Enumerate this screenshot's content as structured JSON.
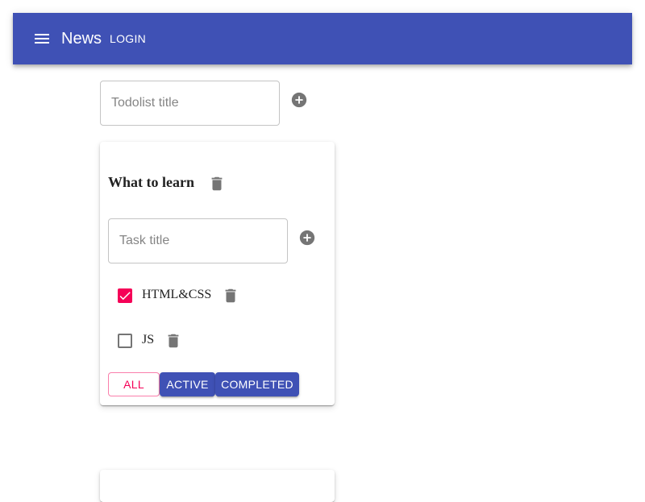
{
  "appbar": {
    "title": "News",
    "login_label": "LOGIN",
    "color": "#3f51b5",
    "menu_icon": "menu-icon"
  },
  "new_todolist": {
    "placeholder": "Todolist title",
    "value": "",
    "add_icon": "add-circle-icon"
  },
  "todolists": [
    {
      "title": "What to learn",
      "delete_icon": "trash-icon",
      "new_task": {
        "placeholder": "Task title",
        "value": "",
        "add_icon": "add-circle-icon"
      },
      "tasks": [
        {
          "label": "HTML&CSS",
          "checked": true
        },
        {
          "label": "JS",
          "checked": false
        }
      ],
      "filters": [
        {
          "label": "ALL",
          "variant": "outlined",
          "color": "#f50057"
        },
        {
          "label": "ACTIVE",
          "variant": "contained",
          "color": "#3f51b5"
        },
        {
          "label": "COMPLETED",
          "variant": "contained",
          "color": "#3f51b5"
        }
      ]
    }
  ]
}
